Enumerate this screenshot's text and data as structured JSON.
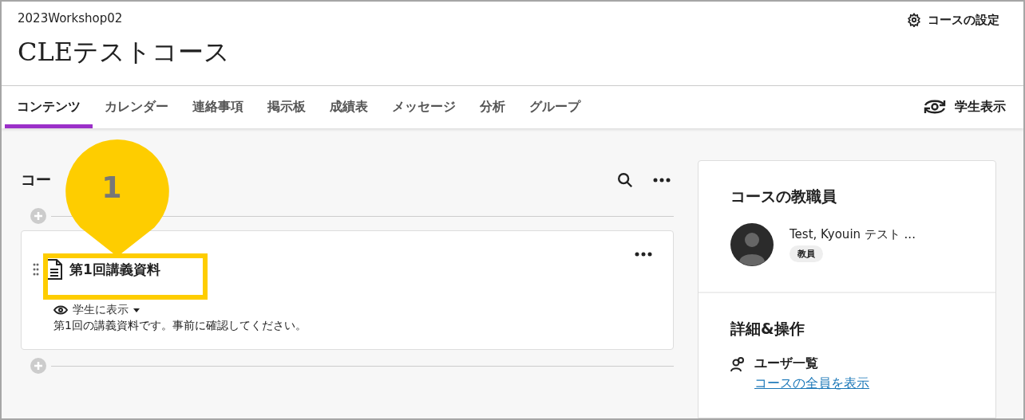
{
  "header": {
    "course_code": "2023Workshop02",
    "title": "CLEテストコース",
    "settings": "コースの設定"
  },
  "tabs": [
    {
      "label": "コンテンツ",
      "selected": true
    },
    {
      "label": "カレンダー",
      "selected": false
    },
    {
      "label": "連絡事項",
      "selected": false
    },
    {
      "label": "掲示板",
      "selected": false
    },
    {
      "label": "成績表",
      "selected": false
    },
    {
      "label": "メッセージ",
      "selected": false
    },
    {
      "label": "分析",
      "selected": false
    },
    {
      "label": "グループ",
      "selected": false
    }
  ],
  "student_view": "学生表示",
  "content": {
    "heading": "コー",
    "items": [
      {
        "title": "第1回講義資料",
        "visibility": "学生に表示",
        "description": "第1回の講義資料です。事前に確認してください。"
      }
    ]
  },
  "sidebar": {
    "staff": {
      "heading": "コースの教職員",
      "members": [
        {
          "name": "Test, Kyouin テスト ...",
          "role": "教員"
        }
      ]
    },
    "details": {
      "heading": "詳細&操作",
      "items": [
        {
          "label": "ユーザ一覧",
          "link": "コースの全員を表示"
        }
      ]
    }
  },
  "callout": {
    "number": "1"
  }
}
